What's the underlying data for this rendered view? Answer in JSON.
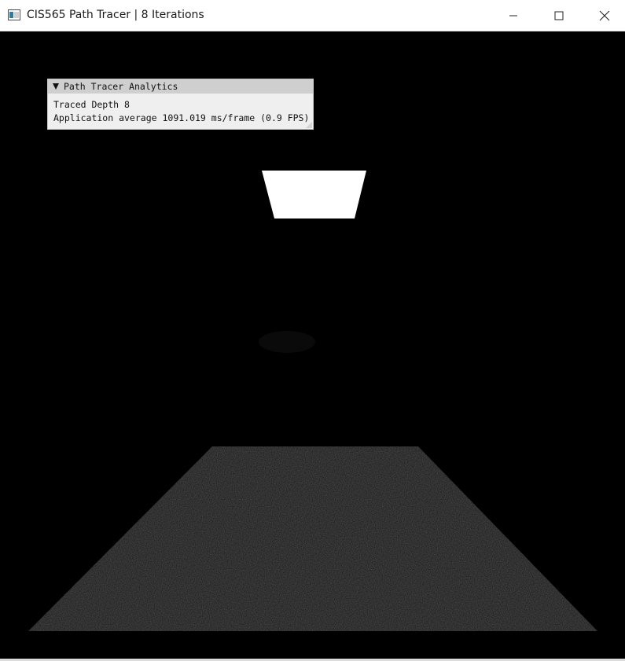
{
  "window": {
    "title": "CIS565 Path Tracer | 8 Iterations",
    "icons": {
      "app": "app-window-icon",
      "minimize": "minimize-icon",
      "maximize": "maximize-icon",
      "close": "close-icon"
    }
  },
  "analytics_panel": {
    "header": "Path Tracer Analytics",
    "collapse_icon": "collapse-triangle-icon",
    "lines": [
      "Traced Depth 8",
      "Application average 1091.019 ms/frame (0.9 FPS)"
    ]
  },
  "colors": {
    "background": "#000000",
    "light": "#ffffff",
    "panel_bg": "#efefef",
    "panel_header": "#cfcfcf",
    "floor": "#1a1a1a"
  }
}
